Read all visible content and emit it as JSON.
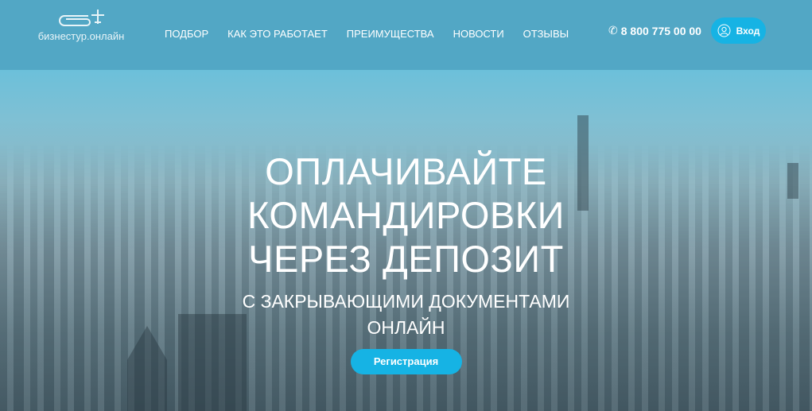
{
  "header": {
    "logo_text": "бизнестур.онлайн",
    "nav": [
      "ПОДБОР",
      "КАК ЭТО РАБОТАЕТ",
      "ПРЕИМУЩЕСТВА",
      "НОВОСТИ",
      "ОТЗЫВЫ"
    ],
    "phone": "8 800 775 00 00",
    "login_label": "Вход"
  },
  "hero": {
    "title_lines": [
      "ОПЛАЧИВАЙТЕ",
      "КОМАНДИРОВКИ",
      "ЧЕРЕЗ ДЕПОЗИТ"
    ],
    "subtitle_lines": [
      "С ЗАКРЫВАЮЩИМИ ДОКУМЕНТАМИ",
      "ОНЛАЙН"
    ],
    "register_label": "Регистрация"
  },
  "colors": {
    "accent": "#16b3e4",
    "header": "#50a5c3"
  }
}
